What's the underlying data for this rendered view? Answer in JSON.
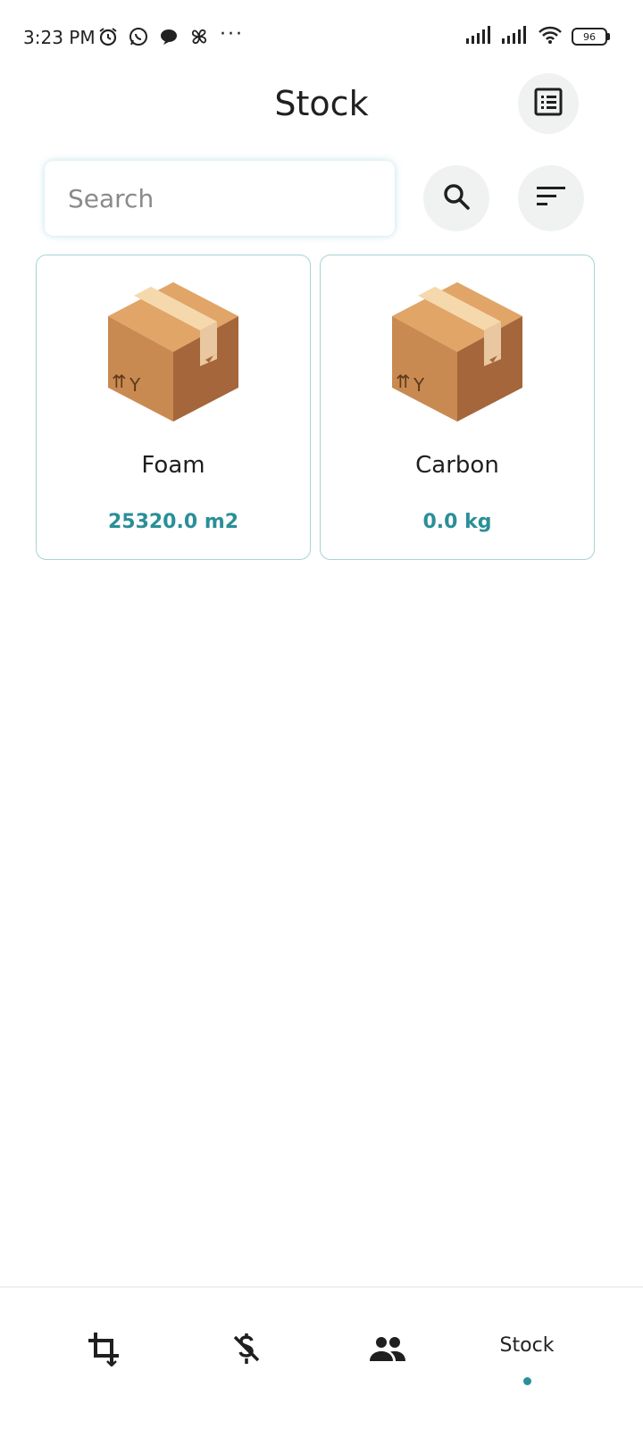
{
  "status_bar": {
    "time": "3:23 PM",
    "battery": "96",
    "icons": [
      "alarm-icon",
      "whatsapp-icon",
      "chat-icon",
      "pinwheel-icon",
      "more-icon",
      "signal-icon",
      "signal-icon",
      "wifi-icon",
      "battery-icon"
    ]
  },
  "header": {
    "title": "Stock",
    "report_icon": "report-icon"
  },
  "search": {
    "placeholder": "Search",
    "value": ""
  },
  "items": [
    {
      "name": "Foam",
      "quantity": "25320.0 m2",
      "icon": "box-icon"
    },
    {
      "name": "Carbon",
      "quantity": "0.0 kg",
      "icon": "box-icon"
    }
  ],
  "bottom_nav": {
    "items": [
      {
        "icon": "crop-icon"
      },
      {
        "icon": "money-off-icon"
      },
      {
        "icon": "people-icon"
      },
      {
        "label": "Stock",
        "active": true
      }
    ]
  },
  "colors": {
    "accent": "#2a8f98",
    "card_border": "#a9d2d4",
    "button_bg": "#f0f2f2"
  }
}
